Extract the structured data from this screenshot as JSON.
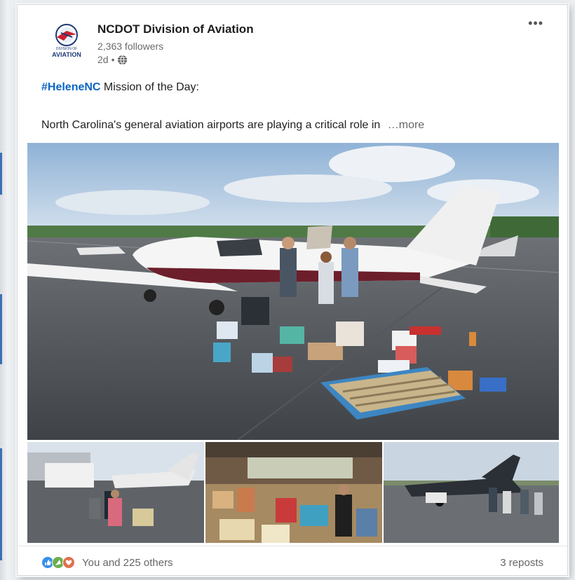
{
  "post": {
    "author": "NCDOT Division of Aviation",
    "followers": "2,363 followers",
    "time": "2d",
    "time_separator": "•",
    "logo_text": "AVIATION",
    "hashtag": "#HeleneNC",
    "headline_rest": " Mission of the Day:",
    "body": "North Carolina's general aviation airports are playing a critical role in",
    "see_more": "…more",
    "more_menu": "•••"
  },
  "social": {
    "reactions_text": "You and 225 others",
    "reposts": "3 reposts"
  },
  "icons": {
    "menu": "ellipsis-icon",
    "visibility": "globe-icon",
    "reactions": [
      "like-icon",
      "celebrate-icon",
      "love-icon"
    ]
  },
  "colors": {
    "hashtag": "#0a66c2",
    "like": "#378fe9",
    "celebrate": "#6dae4f",
    "love": "#df704d"
  }
}
